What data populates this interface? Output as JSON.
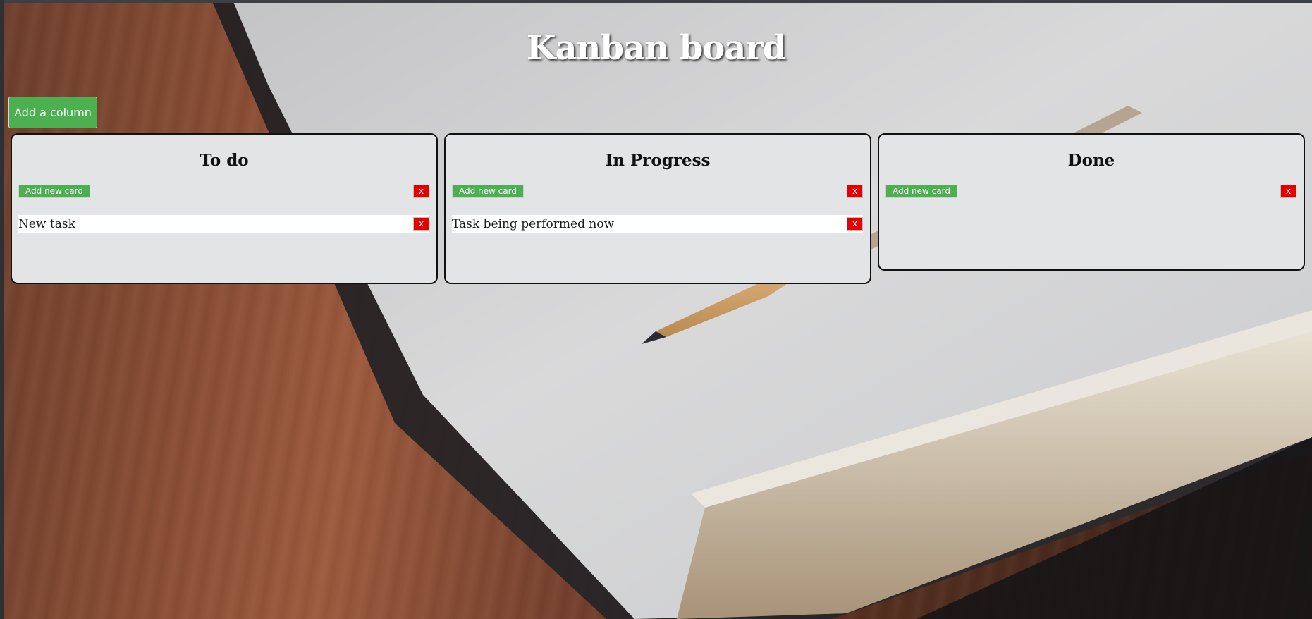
{
  "page": {
    "title": "Kanban board"
  },
  "toolbar": {
    "add_column_label": "Add a column"
  },
  "columns": [
    {
      "title": "To do",
      "add_card_label": "Add new card",
      "delete_label": "x",
      "cards": [
        {
          "text": "New task",
          "delete_label": "x"
        }
      ]
    },
    {
      "title": "In Progress",
      "add_card_label": "Add new card",
      "delete_label": "x",
      "cards": [
        {
          "text": "Task being performed now",
          "delete_label": "x"
        }
      ]
    },
    {
      "title": "Done",
      "add_card_label": "Add new card",
      "delete_label": "x",
      "cards": []
    }
  ],
  "colors": {
    "add_button": "#4caf50",
    "delete_button": "#e50000",
    "column_background": "#e2e4e5",
    "card_background": "#ffffff"
  },
  "background_image": "notebook-and-pencil-on-wooden-desk"
}
